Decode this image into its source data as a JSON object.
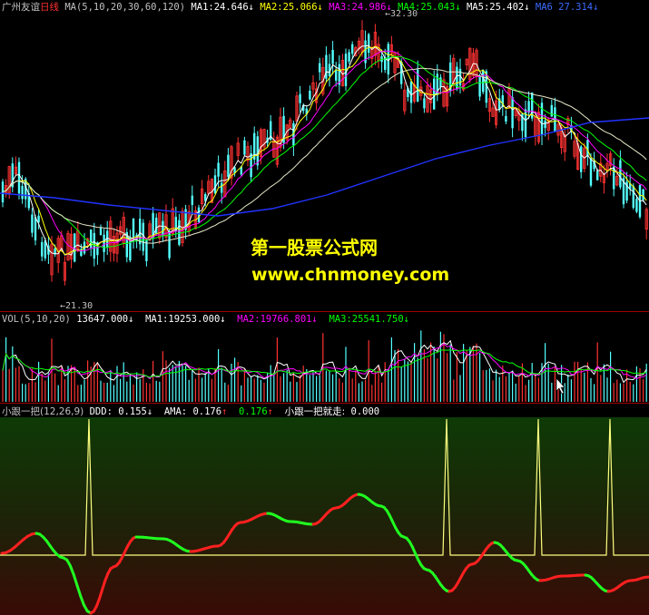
{
  "main_header": {
    "stock_name": "广州友谊",
    "period": "日线",
    "ma_spec": "MA(5,10,20,30,60,120)",
    "ma1_label": "MA1:",
    "ma1_value": "24.646",
    "ma2_label": "MA2:",
    "ma2_value": "25.066",
    "ma3_label": "MA3:",
    "ma3_value": "24.986",
    "ma4_label": "MA4:",
    "ma4_value": "25.043",
    "ma5_label": "MA5:",
    "ma5_value": "25.402",
    "ma6_label": "MA6",
    "ma6_value": "27.314",
    "down_arrow": "↓",
    "up_arrow": "↑"
  },
  "price_labels": {
    "high": "32.30",
    "low": "21.30"
  },
  "vol_header": {
    "spec": "VOL(5,10,20)",
    "vol_value": "13647.000",
    "ma1_label": "MA1:",
    "ma1_value": "19253.000",
    "ma2_label": "MA2:",
    "ma2_value": "19766.801",
    "ma3_label": "MA3:",
    "ma3_value": "25541.750"
  },
  "ind_header": {
    "name": "小跟一把(12,26,9)",
    "ddd_label": "DDD:",
    "ddd_value": "0.155",
    "ama_label": "AMA:",
    "ama_value": "0.176",
    "ama2_value": "0.176",
    "signal_label": "小跟一把就走:",
    "signal_value": "0.000"
  },
  "watermark": {
    "line1": "第一股票公式网",
    "line2": "www.chnmoney.com"
  },
  "colors": {
    "up": "#ff3232",
    "down": "#54ffff",
    "ma1": "#ffffff",
    "ma2": "#ffff00",
    "ma3": "#ff00ff",
    "ma4": "#00ff00",
    "ma5": "#ffffff",
    "ma6": "#0000ff",
    "border": "#a00000",
    "ind_rise": "#ff2020",
    "ind_fall": "#20ff20",
    "signal": "#ffff80"
  }
}
